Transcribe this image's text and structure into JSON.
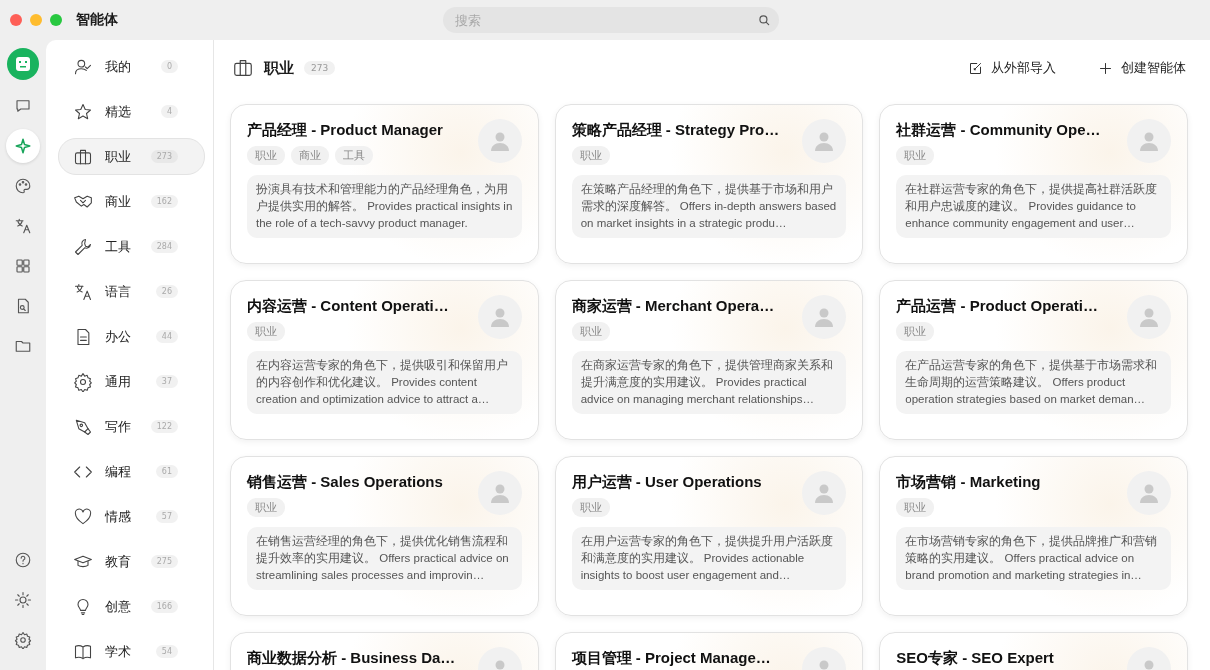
{
  "window": {
    "title": "智能体"
  },
  "search": {
    "placeholder": "搜索"
  },
  "rail": {
    "top": [
      {
        "kind": "chat",
        "selected": false
      },
      {
        "kind": "sparkle",
        "selected": true
      },
      {
        "kind": "palette",
        "selected": false
      },
      {
        "kind": "translate",
        "selected": false
      },
      {
        "kind": "grid",
        "selected": false
      },
      {
        "kind": "file-search",
        "selected": false
      },
      {
        "kind": "folder",
        "selected": false
      }
    ],
    "bottom": [
      {
        "kind": "help",
        "selected": false
      },
      {
        "kind": "sun",
        "selected": false
      },
      {
        "kind": "gear",
        "selected": false
      }
    ]
  },
  "categories": [
    {
      "kind": "user",
      "label": "我的",
      "count": "0",
      "selected": false
    },
    {
      "kind": "star",
      "label": "精选",
      "count": "4",
      "selected": false
    },
    {
      "kind": "briefcase",
      "label": "职业",
      "count": "273",
      "selected": true
    },
    {
      "kind": "handshake",
      "label": "商业",
      "count": "162",
      "selected": false
    },
    {
      "kind": "wrench",
      "label": "工具",
      "count": "284",
      "selected": false
    },
    {
      "kind": "translate",
      "label": "语言",
      "count": "26",
      "selected": false
    },
    {
      "kind": "document",
      "label": "办公",
      "count": "44",
      "selected": false
    },
    {
      "kind": "gear",
      "label": "通用",
      "count": "37",
      "selected": false
    },
    {
      "kind": "pen",
      "label": "写作",
      "count": "122",
      "selected": false
    },
    {
      "kind": "code",
      "label": "编程",
      "count": "61",
      "selected": false
    },
    {
      "kind": "heart",
      "label": "情感",
      "count": "57",
      "selected": false
    },
    {
      "kind": "cap",
      "label": "教育",
      "count": "275",
      "selected": false
    },
    {
      "kind": "bulb",
      "label": "创意",
      "count": "166",
      "selected": false
    },
    {
      "kind": "book",
      "label": "学术",
      "count": "54",
      "selected": false
    }
  ],
  "header": {
    "title": "职业",
    "count": "273",
    "actions": [
      {
        "kind": "import",
        "label": "从外部导入"
      },
      {
        "kind": "create",
        "label": "创建智能体"
      }
    ]
  },
  "cards": [
    {
      "title": "产品经理 - Product Manager",
      "tags": [
        "职业",
        "商业",
        "工具"
      ],
      "description": "扮演具有技术和管理能力的产品经理角色，为用户提供实用的解答。 Provides practical insights in the role of a tech-savvy product manager."
    },
    {
      "title": "策略产品经理 - Strategy Pro…",
      "tags": [
        "职业"
      ],
      "description": "在策略产品经理的角色下，提供基于市场和用户需求的深度解答。 Offers in-depth answers based on market insights in a strategic produ…"
    },
    {
      "title": "社群运营 - Community Ope…",
      "tags": [
        "职业"
      ],
      "description": "在社群运营专家的角色下，提供提高社群活跃度和用户忠诚度的建议。 Provides guidance to enhance community engagement and user…"
    },
    {
      "title": "内容运营 - Content Operati…",
      "tags": [
        "职业"
      ],
      "description": "在内容运营专家的角色下，提供吸引和保留用户的内容创作和优化建议。 Provides content creation and optimization advice to attract a…"
    },
    {
      "title": "商家运营 - Merchant Opera…",
      "tags": [
        "职业"
      ],
      "description": "在商家运营专家的角色下，提供管理商家关系和提升满意度的实用建议。 Provides practical advice on managing merchant relationships…"
    },
    {
      "title": "产品运营 - Product Operati…",
      "tags": [
        "职业"
      ],
      "description": "在产品运营专家的角色下，提供基于市场需求和生命周期的运营策略建议。 Offers product operation strategies based on market deman…"
    },
    {
      "title": "销售运营 - Sales Operations",
      "tags": [
        "职业"
      ],
      "description": "在销售运营经理的角色下，提供优化销售流程和提升效率的实用建议。 Offers practical advice on streamlining sales processes and improvin…"
    },
    {
      "title": "用户运营 - User Operations",
      "tags": [
        "职业"
      ],
      "description": "在用户运营专家的角色下，提供提升用户活跃度和满意度的实用建议。 Provides actionable insights to boost user engagement and…"
    },
    {
      "title": "市场营销 - Marketing",
      "tags": [
        "职业"
      ],
      "description": "在市场营销专家的角色下，提供品牌推广和营销策略的实用建议。 Offers practical advice on brand promotion and marketing strategies in…"
    },
    {
      "title": "商业数据分析 - Business Da…"
    },
    {
      "title": "项目管理 - Project Manage…"
    },
    {
      "title": "SEO专家 - SEO Expert"
    }
  ]
}
